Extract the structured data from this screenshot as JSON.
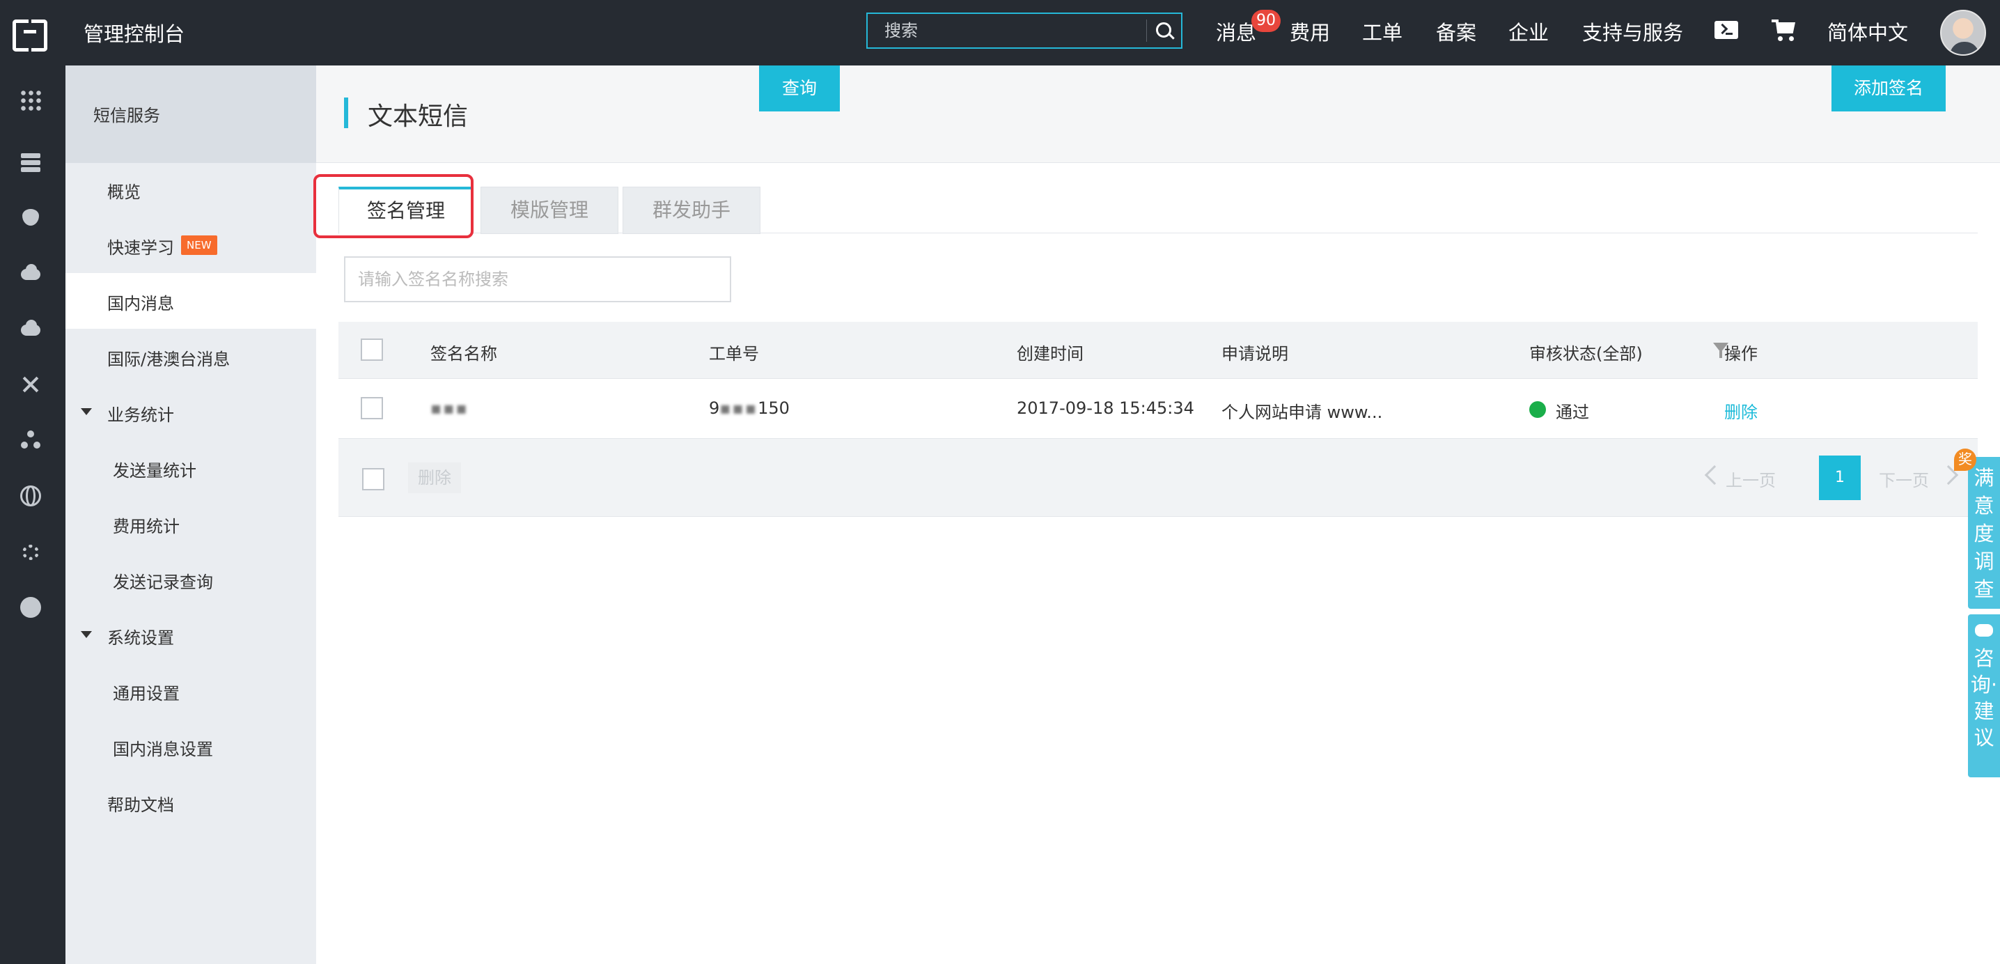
{
  "topbar": {
    "title": "管理控制台",
    "search_placeholder": "搜索",
    "nav": {
      "messages": "消息",
      "messages_badge": "90",
      "billing": "费用",
      "tickets": "工单",
      "icp": "备案",
      "enterprise": "企业",
      "support": "支持与服务",
      "language": "简体中文"
    }
  },
  "rail": {
    "icons": [
      "grid-icon",
      "server-icon",
      "shield-icon",
      "cloud-icon",
      "cloud-upload-icon",
      "network-icon",
      "nodes-icon",
      "globe-icon",
      "gear-icon",
      "circle-icon"
    ]
  },
  "sidebar": {
    "header": "短信服务",
    "items": [
      {
        "label": "概览"
      },
      {
        "label": "快速学习",
        "badge": "NEW"
      },
      {
        "label": "国内消息"
      },
      {
        "label": "国际/港澳台消息"
      },
      {
        "label": "业务统计"
      },
      {
        "label": "发送量统计"
      },
      {
        "label": "费用统计"
      },
      {
        "label": "发送记录查询"
      },
      {
        "label": "系统设置"
      },
      {
        "label": "通用设置"
      },
      {
        "label": "国内消息设置"
      },
      {
        "label": "帮助文档"
      }
    ]
  },
  "main": {
    "title": "文本短信",
    "tabs": [
      {
        "label": "签名管理"
      },
      {
        "label": "模版管理"
      },
      {
        "label": "群发助手"
      }
    ],
    "filter": {
      "placeholder": "请输入签名名称搜索",
      "query_button": "查询",
      "add_button": "添加签名"
    },
    "table": {
      "columns": [
        "签名名称",
        "工单号",
        "创建时间",
        "申请说明",
        "审核状态(全部)",
        "操作"
      ],
      "rows": [
        {
          "name": "▪︎▪︎▪︎",
          "ticket_prefix": "9",
          "ticket_blur": "▪︎▪︎▪︎",
          "ticket_suffix": "150",
          "created": "2017-09-18 15:45:34",
          "description": "个人网站申请 www...",
          "status": "通过",
          "status_color": "#1aae4a",
          "action": "删除"
        }
      ],
      "footer": {
        "delete": "删除",
        "prev": "上一页",
        "page": "1",
        "next": "下一页"
      }
    }
  },
  "floating": {
    "prize_badge": "奖",
    "survey": "满意度调查",
    "consult": "咨询·建议"
  },
  "colors": {
    "accent": "#1dbbd9",
    "topbar_bg": "#262b32",
    "highlight": "#e8303d",
    "badge": "#e8463c"
  }
}
